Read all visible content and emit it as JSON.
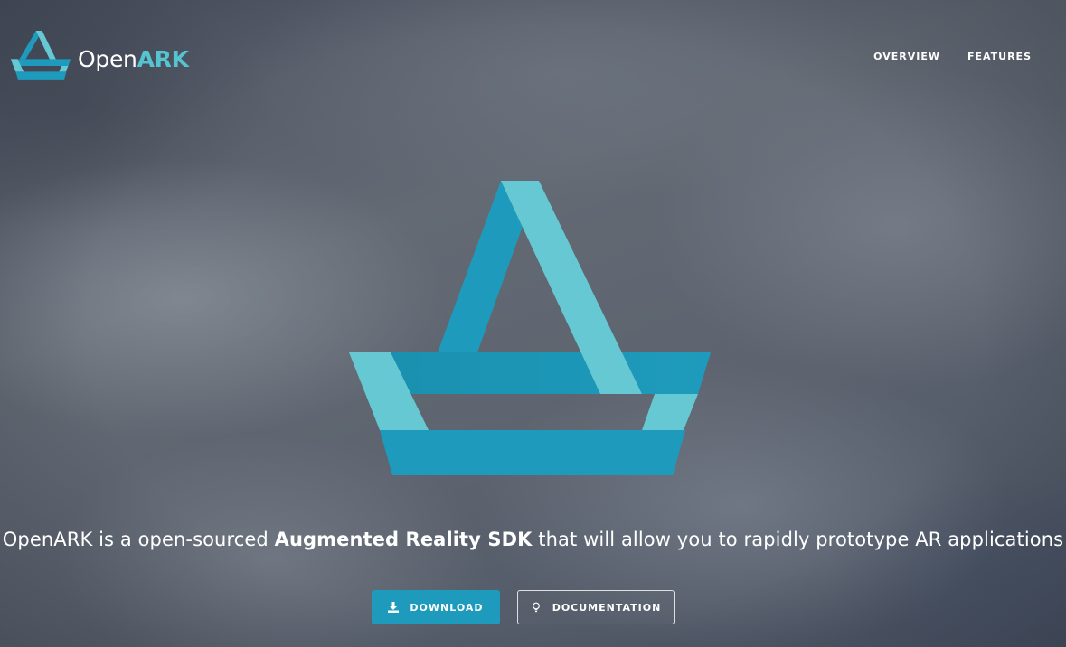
{
  "header": {
    "brand": {
      "logo_icon": "openark-logo-icon",
      "name_part1": "Open",
      "name_part2": "ARK"
    },
    "nav": [
      {
        "label": "OVERVIEW"
      },
      {
        "label": "FEATURES"
      }
    ]
  },
  "hero": {
    "logo_icon": "openark-logo-icon",
    "tagline": {
      "before": "OpenARK is a open-sourced ",
      "emphasis": "Augmented Reality SDK",
      "after": " that will allow you to rapidly prototype AR applications"
    },
    "buttons": {
      "download": {
        "label": "DOWNLOAD",
        "icon": "download-icon"
      },
      "documentation": {
        "label": "DOCUMENTATION",
        "icon": "lightbulb-icon"
      }
    }
  },
  "colors": {
    "accent_dark": "#1e9bbc",
    "accent_light": "#66c8d2",
    "background": "#59606b"
  }
}
